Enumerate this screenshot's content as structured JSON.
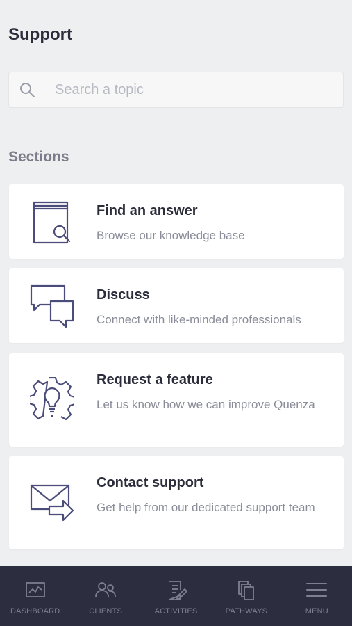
{
  "header": {
    "title": "Support"
  },
  "search": {
    "placeholder": "Search a topic"
  },
  "sections": {
    "heading": "Sections",
    "cards": [
      {
        "title": "Find an answer",
        "description": "Browse our knowledge base",
        "icon": "book-search-icon"
      },
      {
        "title": "Discuss",
        "description": "Connect with like-minded professionals",
        "icon": "chat-bubbles-icon"
      },
      {
        "title": "Request a feature",
        "description": "Let us know how we can improve Quenza",
        "icon": "lightbulb-gear-icon"
      },
      {
        "title": "Contact support",
        "description": "Get help from our dedicated support team",
        "icon": "envelope-arrow-icon"
      }
    ]
  },
  "nav": {
    "items": [
      {
        "label": "DASHBOARD",
        "icon": "chart-monitor-icon"
      },
      {
        "label": "CLIENTS",
        "icon": "people-icon"
      },
      {
        "label": "ACTIVITIES",
        "icon": "document-pencil-icon"
      },
      {
        "label": "PATHWAYS",
        "icon": "stacked-pages-icon"
      },
      {
        "label": "MENU",
        "icon": "hamburger-menu-icon"
      }
    ]
  },
  "colors": {
    "background": "#eeeff1",
    "card": "#ffffff",
    "icon_stroke": "#4a4c7a",
    "nav_background": "#2c2e3f",
    "nav_text": "#7d8093"
  }
}
